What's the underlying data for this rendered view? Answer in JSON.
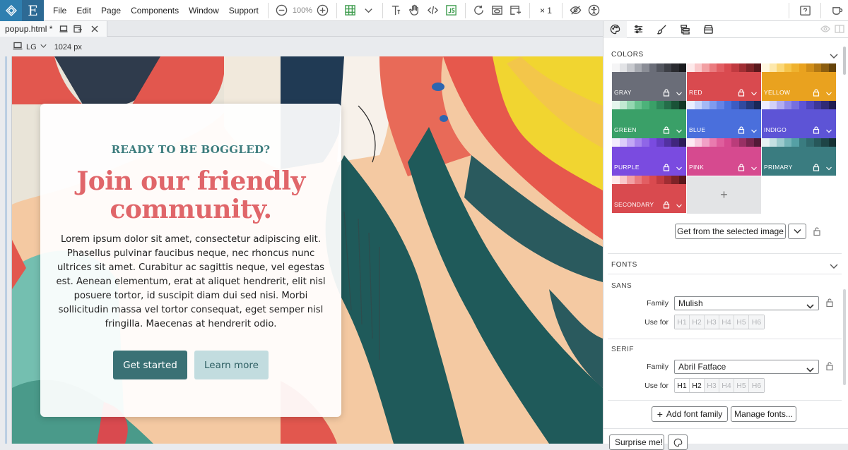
{
  "menu": {
    "items": [
      "File",
      "Edit",
      "Page",
      "Components",
      "Window",
      "Support"
    ]
  },
  "toolbar": {
    "zoom": "100%",
    "multiplier": "× 1",
    "icons": [
      "zoom-out-icon",
      "zoom-in-icon",
      "grid-icon",
      "chevron-down-icon",
      "text-icon",
      "hand-icon",
      "code-icon",
      "js-icon",
      "refresh-icon",
      "preview-icon",
      "export-icon",
      "hide-icon",
      "accessibility-icon",
      "help-icon",
      "coffee-icon"
    ]
  },
  "tabs": {
    "file_name": "popup.html *"
  },
  "device": {
    "size_label": "LG",
    "width_label": "1024 px"
  },
  "card": {
    "eyebrow": "READY TO BE BOGGLED?",
    "headline": "Join our friendly community.",
    "body": "Lorem ipsum dolor sit amet, consectetur adipiscing elit. Phasellus pulvinar faucibus neque, nec rhoncus nunc ultrices sit amet. Curabitur ac sagittis neque, vel egestas est. Aenean elementum, erat at aliquet hendrerit, elit nisl posuere tortor, id suscipit diam dui sed nisi. Morbi sollicitudin massa vel tortor consequat, eget semper nisl fringilla. Maecenas at hendrerit odio.",
    "primary_button": "Get started",
    "secondary_button": "Learn more"
  },
  "panel": {
    "colors_heading": "COLORS",
    "swatches": [
      {
        "name": "GRAY",
        "color": "#6a6d78",
        "shades": [
          "#f5f5f6",
          "#e2e3e6",
          "#c7c9ce",
          "#a7aab1",
          "#8a8d96",
          "#6a6d78",
          "#52555e",
          "#3d3f46",
          "#2a2b30",
          "#1a1b1e"
        ]
      },
      {
        "name": "RED",
        "color": "#d94a4f",
        "shades": [
          "#fde9ea",
          "#f9c8ca",
          "#f2a0a3",
          "#ea7b7f",
          "#e25e63",
          "#d94a4f",
          "#c03a40",
          "#a02e33",
          "#7d2327",
          "#5a181c"
        ]
      },
      {
        "name": "YELLOW",
        "color": "#e9a21f",
        "shades": [
          "#fff7df",
          "#fde8ac",
          "#fbd776",
          "#f6c44a",
          "#efb22f",
          "#e9a21f",
          "#d08d18",
          "#b17714",
          "#8c5e10",
          "#66440b"
        ]
      },
      {
        "name": "GREEN",
        "color": "#3aa068",
        "shades": [
          "#e6f6ed",
          "#c2e9d2",
          "#94d7b1",
          "#69c390",
          "#4cb27a",
          "#3aa068",
          "#2e875a",
          "#246d49",
          "#1a5237",
          "#113826"
        ]
      },
      {
        "name": "BLUE",
        "color": "#4a6fdc",
        "shades": [
          "#e9efff",
          "#c9d6fb",
          "#a4b9f5",
          "#7f9bee",
          "#6483e6",
          "#4a6fdc",
          "#3c5cc2",
          "#304a9f",
          "#25397b",
          "#1a2858"
        ]
      },
      {
        "name": "INDIGO",
        "color": "#5d54d6",
        "shades": [
          "#eeedfd",
          "#d3d0f8",
          "#b2acf1",
          "#908ae9",
          "#766fdf",
          "#5d54d6",
          "#4d45bc",
          "#3e3799",
          "#302a76",
          "#211d52"
        ]
      },
      {
        "name": "PURPLE",
        "color": "#7a4be0",
        "shades": [
          "#f2ecfd",
          "#ddcdfa",
          "#c3a8f5",
          "#a784ee",
          "#8f66e7",
          "#7a4be0",
          "#663dc4",
          "#5331a1",
          "#40267d",
          "#2d1b58"
        ]
      },
      {
        "name": "PINK",
        "color": "#d64a8f",
        "shades": [
          "#fdeaf3",
          "#f8c9df",
          "#f1a1c7",
          "#e97baf",
          "#df5e9d",
          "#d64a8f",
          "#ba3c7a",
          "#983064",
          "#76254e",
          "#531a37"
        ]
      },
      {
        "name": "PRIMARY",
        "color": "#3a7c80",
        "shades": [
          "#e7f2f3",
          "#c4e0e2",
          "#9ccbce",
          "#74b4b8",
          "#55a0a5",
          "#3a7c80",
          "#306a6e",
          "#27575a",
          "#1e4446",
          "#153133"
        ]
      },
      {
        "name": "SECONDARY",
        "color": "#d94a4f",
        "shades": [
          "#fde9ea",
          "#f9c8ca",
          "#f2a0a3",
          "#ea7b7f",
          "#e25e63",
          "#d94a4f",
          "#c03a40",
          "#a02e33",
          "#7d2327",
          "#5a181c"
        ]
      }
    ],
    "add_color": "+",
    "get_image_button": "Get from the selected image",
    "fonts_heading": "FONTS",
    "sans": {
      "heading": "SANS",
      "family_label": "Family",
      "family_value": "Mulish",
      "use_for_label": "Use for",
      "headings": [
        "H1",
        "H2",
        "H3",
        "H4",
        "H5",
        "H6"
      ],
      "active": []
    },
    "serif": {
      "heading": "SERIF",
      "family_label": "Family",
      "family_value": "Abril Fatface",
      "use_for_label": "Use for",
      "headings": [
        "H1",
        "H2",
        "H3",
        "H4",
        "H5",
        "H6"
      ],
      "active": [
        "H1",
        "H2"
      ]
    },
    "add_font_button": "Add font family",
    "manage_fonts_button": "Manage fonts...",
    "surprise_button": "Surprise me!"
  }
}
